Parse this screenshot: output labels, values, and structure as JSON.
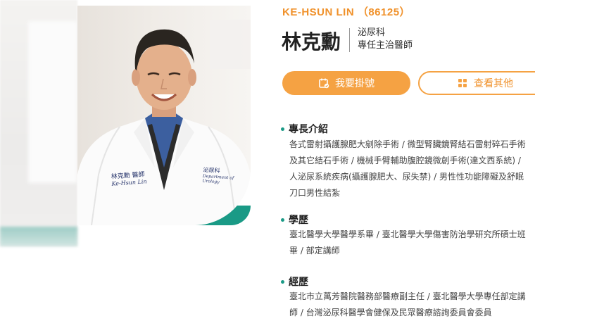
{
  "doctor": {
    "name_en": "KE-HSUN LIN （86125）",
    "name_zh": "林克勳",
    "department": "泌尿科",
    "title": "專任主治醫師"
  },
  "actions": {
    "register_label": "我要掛號",
    "more_label": "查看其他"
  },
  "sections": {
    "specialty": {
      "title": "專長介紹",
      "body": "各式雷射攝護腺肥大剜除手術 / 微型腎臟鏡腎結石雷射碎石手術\n及其它結石手術 / 機械手臂輔助腹腔鏡微創手術(達文西系統) /\n人泌尿系統疾病(攝護腺肥大、尿失禁) / 男性性功能障礙及舒眠\n刀口男性結紮"
    },
    "education": {
      "title": "學歷",
      "body": "臺北醫學大學醫學系畢 / 臺北醫學大學傷害防治學研究所碩士班\n畢 / 部定講師"
    },
    "experience": {
      "title": "經歷",
      "body": "臺北市立萬芳醫院醫務部醫療副主任 / 臺北醫學大學專任部定講\n師 / 台灣泌尿科醫學會健保及民眾醫療諮詢委員會委員"
    }
  },
  "coat": {
    "left_embroidery": "林克勳 醫師",
    "left_sub": "Ke-Hsun Lin",
    "right_embroidery": "泌尿科",
    "right_sub": "Department of Urology"
  },
  "colors": {
    "accent_orange": "#f5a243",
    "teal": "#1a9a86"
  },
  "icons": {
    "register": "calendar-check-icon",
    "more": "grid-icon"
  }
}
